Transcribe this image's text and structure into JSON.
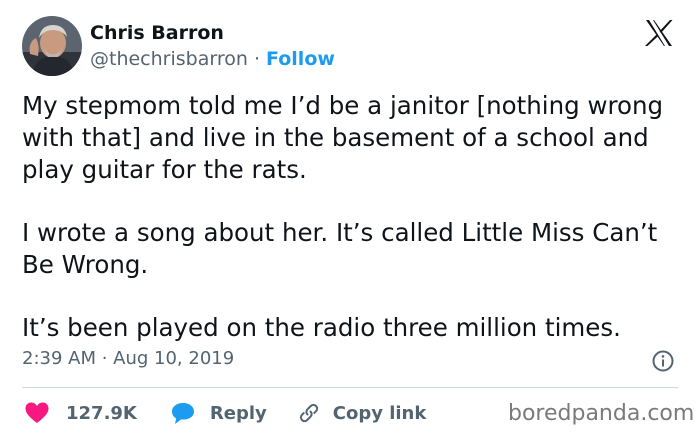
{
  "author": {
    "name": "Chris Barron",
    "handle": "@thechrisbarron",
    "separator": " · ",
    "follow_label": "Follow"
  },
  "tweet": {
    "paragraphs": [
      "My stepmom told me I’d be a janitor [nothing wrong with that] and live in the basement of a school and play guitar for the rats.",
      "I wrote a song about her. It’s called Little Miss Can’t Be Wrong.",
      "It’s been played on the radio three million times."
    ],
    "timestamp": "2:39 AM · Aug 10, 2019"
  },
  "actions": {
    "like_count": "127.9K",
    "reply_label": "Reply",
    "copy_link_label": "Copy link"
  },
  "watermark": "boredpanda.com",
  "icons": {
    "platform": "x-logo-icon",
    "info": "info-icon",
    "like": "heart-icon",
    "reply": "speech-bubble-icon",
    "copy_link": "link-icon"
  },
  "colors": {
    "text": "#0f1419",
    "secondary": "#536471",
    "accent": "#1d9bf0",
    "like": "#f91880"
  }
}
